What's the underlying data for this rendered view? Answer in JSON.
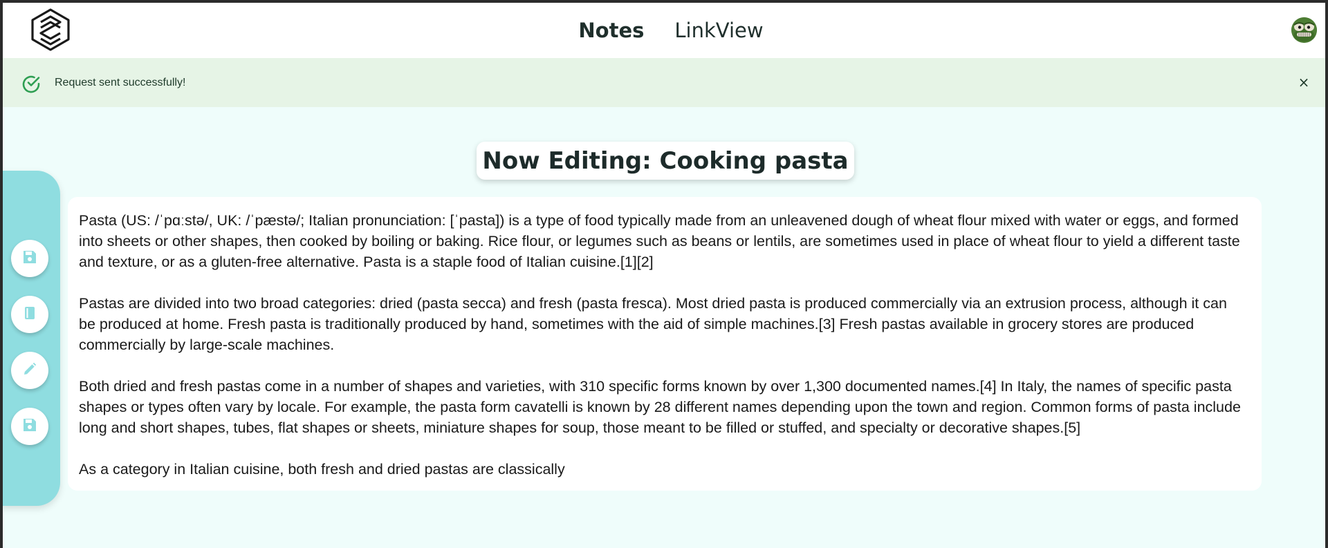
{
  "header": {
    "nav": [
      {
        "label": "Notes",
        "active": true
      },
      {
        "label": "LinkView",
        "active": false
      }
    ],
    "logo_icon": "hexagon-s-logo-icon",
    "avatar_icon": "frog-avatar-icon"
  },
  "alert": {
    "message": "Request sent successfully!",
    "icon": "check-circle-icon",
    "close_icon": "close-icon",
    "close_label": "×"
  },
  "editor": {
    "title": "Now Editing: Cooking pasta",
    "paragraphs": [
      "Pasta (US: /ˈpɑːstə/, UK: /ˈpæstə/; Italian pronunciation: [ˈpasta]) is a type of food typically made from an unleavened dough of wheat flour mixed with water or eggs, and formed into sheets or other shapes, then cooked by boiling or baking. Rice flour, or legumes such as beans or lentils, are sometimes used in place of wheat flour to yield a different taste and texture, or as a gluten-free alternative. Pasta is a staple food of Italian cuisine.[1][2]",
      "Pastas are divided into two broad categories: dried (pasta secca) and fresh (pasta fresca). Most dried pasta is produced commercially via an extrusion process, although it can be produced at home. Fresh pasta is traditionally produced by hand, sometimes with the aid of simple machines.[3] Fresh pastas available in grocery stores are produced commercially by large-scale machines.",
      "Both dried and fresh pastas come in a number of shapes and varieties, with 310 specific forms known by over 1,300 documented names.[4] In Italy, the names of specific pasta shapes or types often vary by locale. For example, the pasta form cavatelli is known by 28 different names depending upon the town and region. Common forms of pasta include long and short shapes, tubes, flat shapes or sheets, miniature shapes for soup, those meant to be filled or stuffed, and specialty or decorative shapes.[5]",
      "As a category in Italian cuisine, both fresh and dried pastas are classically"
    ]
  },
  "toolbar": {
    "buttons": [
      {
        "icon": "save-icon"
      },
      {
        "icon": "book-icon"
      },
      {
        "icon": "pencil-icon"
      },
      {
        "icon": "save-icon"
      }
    ]
  },
  "colors": {
    "background": "#effdfb",
    "toolbar": "#8fdde0",
    "alert_bg": "#e6f4e6",
    "success": "#2e9e52",
    "toolbar_icon": "#8fdde0"
  }
}
